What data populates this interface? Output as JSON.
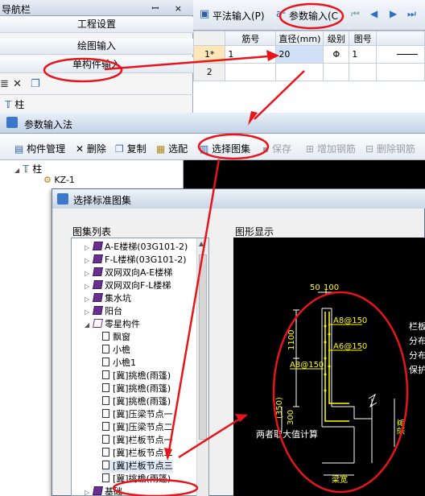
{
  "nav": {
    "title": "导航栏",
    "controls": "ꟷ ×",
    "items": [
      "工程设置",
      "绘图输入",
      "单构件输入"
    ],
    "tree_root": "柱"
  },
  "input_tabs": {
    "tab1": "平法输入(P)",
    "tab2": "参数输入(C",
    "nav_arrows": [
      "⏮",
      "◀",
      "▶",
      "⏭"
    ]
  },
  "grid": {
    "headers": [
      "筋号",
      "直径(mm)",
      "级别",
      "图号"
    ],
    "rows": [
      {
        "rownum": "1*",
        "jinhao": "1",
        "diameter": "20",
        "grade": "Φ",
        "tuhao": "1"
      },
      {
        "rownum": "2",
        "jinhao": "",
        "diameter": "",
        "grade": "",
        "tuhao": ""
      }
    ]
  },
  "param_dialog": {
    "title": "参数输入法",
    "toolbar": {
      "component_mgmt": "构件管理",
      "delete": "删除",
      "copy": "复制",
      "select": "选配",
      "select_atlas": "选择图集",
      "save": "保存",
      "add_rebar": "增加钢筋",
      "remove_rebar": "删除钢筋"
    },
    "tree": {
      "root": "柱",
      "child": "KZ-1"
    }
  },
  "atlas_dialog": {
    "title": "选择标准图集",
    "list_label": "图集列表",
    "figure_label": "图形显示",
    "items": [
      {
        "kind": "book",
        "expand": "▷",
        "text": "A-E楼梯(03G101-2)"
      },
      {
        "kind": "book",
        "expand": "▷",
        "text": "F-L楼梯(03G101-2)"
      },
      {
        "kind": "book",
        "expand": "▷",
        "text": "双网双向A-E楼梯"
      },
      {
        "kind": "book",
        "expand": "▷",
        "text": "双网双向F-L楼梯"
      },
      {
        "kind": "book",
        "expand": "▷",
        "text": "集水坑"
      },
      {
        "kind": "book",
        "expand": "▷",
        "text": "阳台"
      },
      {
        "kind": "openbook",
        "expand": "◢",
        "text": "零星构件"
      },
      {
        "kind": "doc",
        "expand": "",
        "text": "飘窗"
      },
      {
        "kind": "doc",
        "expand": "",
        "text": "小檐"
      },
      {
        "kind": "doc",
        "expand": "",
        "text": "小檐1"
      },
      {
        "kind": "doc",
        "expand": "",
        "text": "[冀]挑檐(雨篷)"
      },
      {
        "kind": "doc",
        "expand": "",
        "text": "[冀]挑檐(雨篷)"
      },
      {
        "kind": "doc",
        "expand": "",
        "text": "[冀]挑檐(雨篷)"
      },
      {
        "kind": "doc",
        "expand": "",
        "text": "[冀]压梁节点一"
      },
      {
        "kind": "doc",
        "expand": "",
        "text": "[冀]压梁节点二"
      },
      {
        "kind": "doc",
        "expand": "",
        "text": "[冀]栏板节点一"
      },
      {
        "kind": "doc",
        "expand": "",
        "text": "[冀]栏板节点二"
      },
      {
        "kind": "doc",
        "expand": "",
        "text": "[冀]栏板节点三"
      },
      {
        "kind": "doc",
        "expand": "",
        "text": "[冀]挑檐(雨篷)"
      },
      {
        "kind": "book",
        "expand": "▷",
        "text": "基础"
      }
    ],
    "selected_index": 17,
    "figure": {
      "dims": [
        "50",
        "100"
      ],
      "rebars": [
        "A8@150",
        "A6@150",
        "A8@150"
      ],
      "heights": [
        "1100",
        "300",
        "(350)"
      ],
      "note": "两者取大值计算",
      "bottom_label": "梁宽",
      "right_label": "梁高",
      "side_text": [
        "栏板",
        "分布",
        "分布",
        "保护"
      ]
    }
  },
  "colors": {
    "annotation": "#e8141b",
    "figure_bg": "#000000",
    "figure_line": "#ffffff",
    "figure_text": "#ffff00",
    "selected_cell": "#cfe0f7"
  }
}
